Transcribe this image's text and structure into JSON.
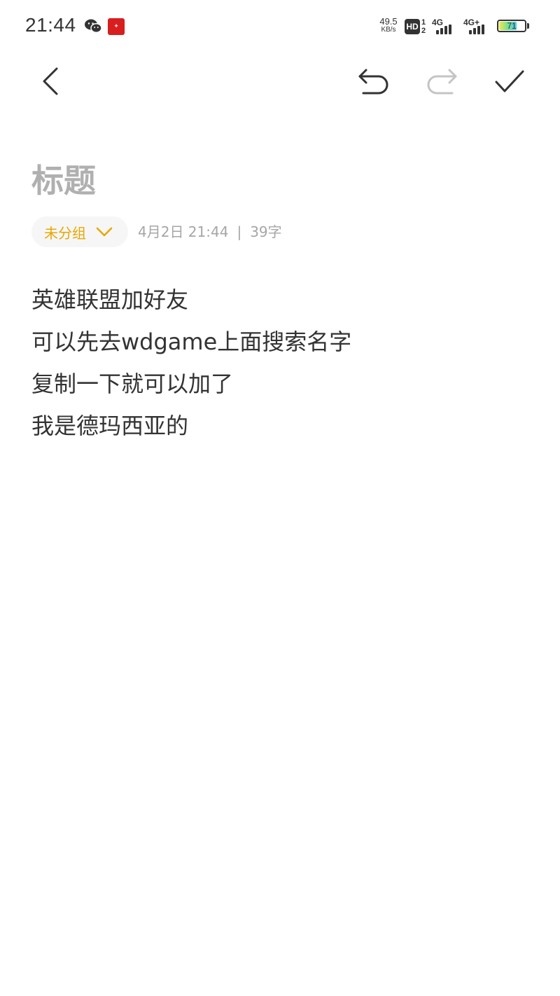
{
  "status_bar": {
    "time": "21:44",
    "net_speed_value": "49.5",
    "net_speed_unit": "KB/s",
    "hd_label": "HD",
    "hd_sub": "1 2",
    "signal1_label": "4G",
    "signal2_label": "4G+",
    "battery_level": "71",
    "battery_fraction": 0.71,
    "icons": [
      "wechat-icon",
      "app-notification-icon",
      "hd-icon",
      "signal-icon",
      "battery-icon"
    ]
  },
  "toolbar": {
    "icons": [
      "back-arrow-icon",
      "undo-icon",
      "redo-icon",
      "check-icon"
    ]
  },
  "note": {
    "title_placeholder": "标题",
    "group": "未分组",
    "date": "4月2日 21:44",
    "separator": "|",
    "char_count": "39字",
    "lines": [
      "英雄联盟加好友",
      "可以先去wdgame上面搜索名字",
      "复制一下就可以加了",
      "我是德玛西亚的"
    ]
  },
  "colors": {
    "text": "#333333",
    "title_placeholder": "#b0b0b0",
    "group_accent": "#e6a800",
    "meta": "#a6a6a6",
    "disabled_icon": "#c4c4c4"
  }
}
